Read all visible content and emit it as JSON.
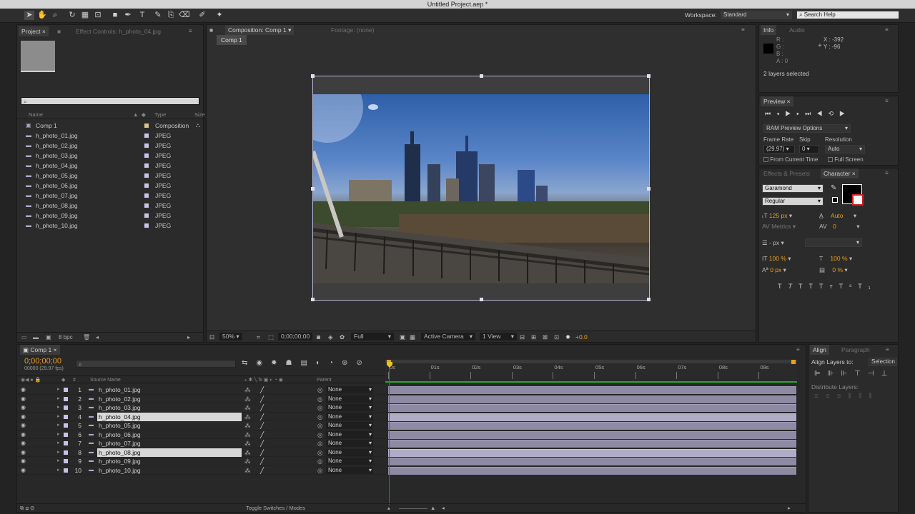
{
  "window": {
    "title": "Untitled Project.aep *"
  },
  "toolbar": {
    "workspace_label": "Workspace:",
    "workspace_value": "Standard",
    "search_placeholder": "Search Help"
  },
  "project_panel": {
    "tab_project": "Project",
    "tab_effect_controls": "Effect Controls: h_photo_04.jpg",
    "search_placeholder": "",
    "col_name": "Name",
    "col_type": "Type",
    "col_size": "Size",
    "items": [
      {
        "name": "Comp 1",
        "type": "Composition",
        "color": "#d8c58a",
        "icon": "composition-icon"
      },
      {
        "name": "h_photo_01.jpg",
        "type": "JPEG",
        "color": "#c9c4e6",
        "icon": "image-icon"
      },
      {
        "name": "h_photo_02.jpg",
        "type": "JPEG",
        "color": "#c9c4e6",
        "icon": "image-icon"
      },
      {
        "name": "h_photo_03.jpg",
        "type": "JPEG",
        "color": "#c9c4e6",
        "icon": "image-icon"
      },
      {
        "name": "h_photo_04.jpg",
        "type": "JPEG",
        "color": "#c9c4e6",
        "icon": "image-icon"
      },
      {
        "name": "h_photo_05.jpg",
        "type": "JPEG",
        "color": "#c9c4e6",
        "icon": "image-icon"
      },
      {
        "name": "h_photo_06.jpg",
        "type": "JPEG",
        "color": "#c9c4e6",
        "icon": "image-icon"
      },
      {
        "name": "h_photo_07.jpg",
        "type": "JPEG",
        "color": "#c9c4e6",
        "icon": "image-icon"
      },
      {
        "name": "h_photo_08.jpg",
        "type": "JPEG",
        "color": "#c9c4e6",
        "icon": "image-icon"
      },
      {
        "name": "h_photo_09.jpg",
        "type": "JPEG",
        "color": "#c9c4e6",
        "icon": "image-icon"
      },
      {
        "name": "h_photo_10.jpg",
        "type": "JPEG",
        "color": "#c9c4e6",
        "icon": "image-icon"
      }
    ],
    "bpc": "8 bpc"
  },
  "composition_panel": {
    "tab_composition": "Composition: Comp 1",
    "tab_footage": "Footage: (none)",
    "comp_tab": "Comp 1",
    "zoom": "50%",
    "timecode": "0;00;00;00",
    "resolution": "Full",
    "camera": "Active Camera",
    "view": "1 View",
    "exposure": "+0.0"
  },
  "info_panel": {
    "tab_info": "Info",
    "tab_audio": "Audio",
    "r": "R :",
    "g": "G :",
    "b": "B :",
    "a": "A : 0",
    "x": "X : -392",
    "y": "Y : -96",
    "status": "2 layers selected"
  },
  "preview_panel": {
    "tab": "Preview",
    "ram_options": "RAM Preview Options",
    "frame_rate_label": "Frame Rate",
    "skip_label": "Skip",
    "resolution_label": "Resolution",
    "frame_rate": "(29.97)",
    "skip": "0",
    "resolution": "Auto",
    "from_current": "From Current Time",
    "full_screen": "Full Screen"
  },
  "character_panel": {
    "tab_effects": "Effects & Presets",
    "tab_character": "Character",
    "font": "Garamond",
    "style": "Regular",
    "size": "125 px",
    "leading": "Auto",
    "kerning": "Metrics",
    "tracking": "0",
    "stroke": "- px",
    "vscale": "100 %",
    "hscale": "100 %",
    "baseline": "0 px",
    "tsume": "0 %"
  },
  "align_panel": {
    "tab_align": "Align",
    "tab_paragraph": "Paragraph",
    "align_to_label": "Align Layers to:",
    "align_to_value": "Selection",
    "distribute_label": "Distribute Layers:"
  },
  "timeline": {
    "tab": "Comp 1",
    "timecode": "0;00;00;00",
    "fps": "00000 (29.97 fps)",
    "col_source": "Source Name",
    "col_parent": "Parent",
    "ruler": [
      "0s",
      "01s",
      "02s",
      "03s",
      "04s",
      "05s",
      "06s",
      "07s",
      "08s",
      "09s"
    ],
    "toggle_label": "Toggle Switches / Modes",
    "layers": [
      {
        "num": "1",
        "name": "h_photo_01.jpg",
        "parent": "None",
        "selected": false
      },
      {
        "num": "2",
        "name": "h_photo_02.jpg",
        "parent": "None",
        "selected": false
      },
      {
        "num": "3",
        "name": "h_photo_03.jpg",
        "parent": "None",
        "selected": false
      },
      {
        "num": "4",
        "name": "h_photo_04.jpg",
        "parent": "None",
        "selected": true
      },
      {
        "num": "5",
        "name": "h_photo_05.jpg",
        "parent": "None",
        "selected": false
      },
      {
        "num": "6",
        "name": "h_photo_06.jpg",
        "parent": "None",
        "selected": false
      },
      {
        "num": "7",
        "name": "h_photo_07.jpg",
        "parent": "None",
        "selected": false
      },
      {
        "num": "8",
        "name": "h_photo_08.jpg",
        "parent": "None",
        "selected": true
      },
      {
        "num": "9",
        "name": "h_photo_09.jpg",
        "parent": "None",
        "selected": false
      },
      {
        "num": "10",
        "name": "h_photo_10.jpg",
        "parent": "None",
        "selected": false
      }
    ]
  },
  "colors": {
    "accent": "#e9a01f",
    "label_purple": "#c9c4e6",
    "bar": "#8f8aa3",
    "work_area": "#22aa22"
  }
}
